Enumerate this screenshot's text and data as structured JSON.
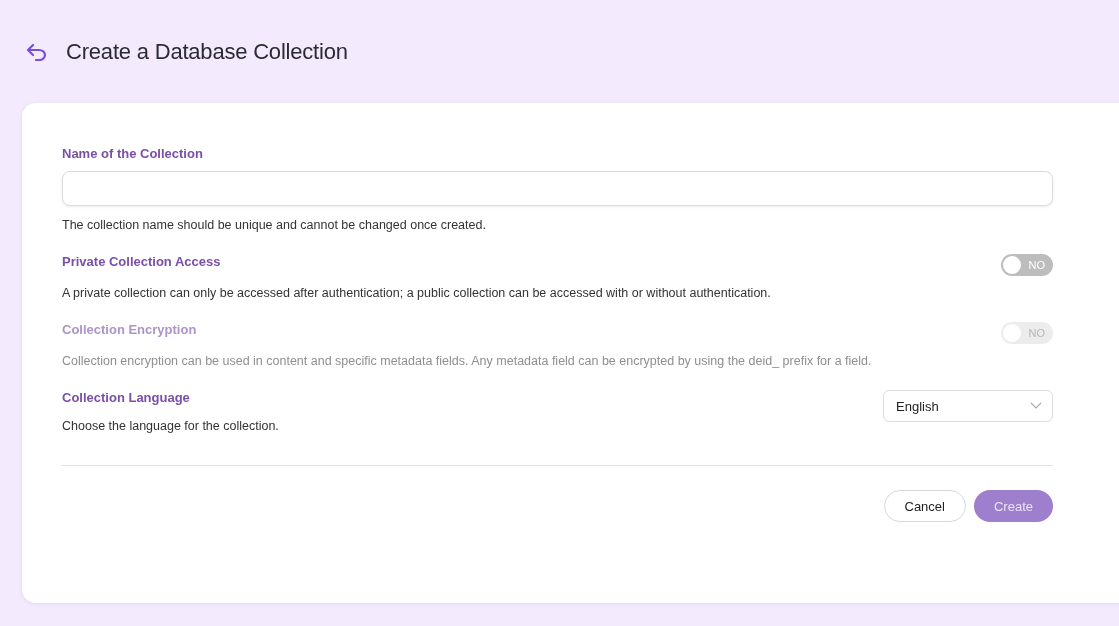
{
  "header": {
    "title": "Create a Database Collection"
  },
  "sections": [
    {
      "kind": "text",
      "label": "Name of the Collection",
      "help": "The collection name should be unique and cannot be changed once created.",
      "disabled": false
    },
    {
      "kind": "toggle",
      "label": "Private Collection Access",
      "on": false,
      "toggle_text": "NO",
      "help": "A private collection can only be accessed after authentication; a public collection can be accessed with or without authentication.",
      "disabled": false
    },
    {
      "kind": "toggle",
      "label": "Collection Encryption",
      "on": false,
      "toggle_text": "NO",
      "help": "Collection encryption can be used in content and specific metadata fields. Any metadata field can be encrypted by using the deid_ prefix for a field.",
      "disabled": true
    },
    {
      "kind": "select",
      "label": "Collection Language",
      "value": "English",
      "help": "Choose the language for the collection.",
      "disabled": false
    }
  ],
  "buttons": [
    {
      "label": "Cancel",
      "kind": "secondary",
      "disabled": false
    },
    {
      "label": "Create",
      "kind": "primary",
      "disabled": true
    }
  ]
}
